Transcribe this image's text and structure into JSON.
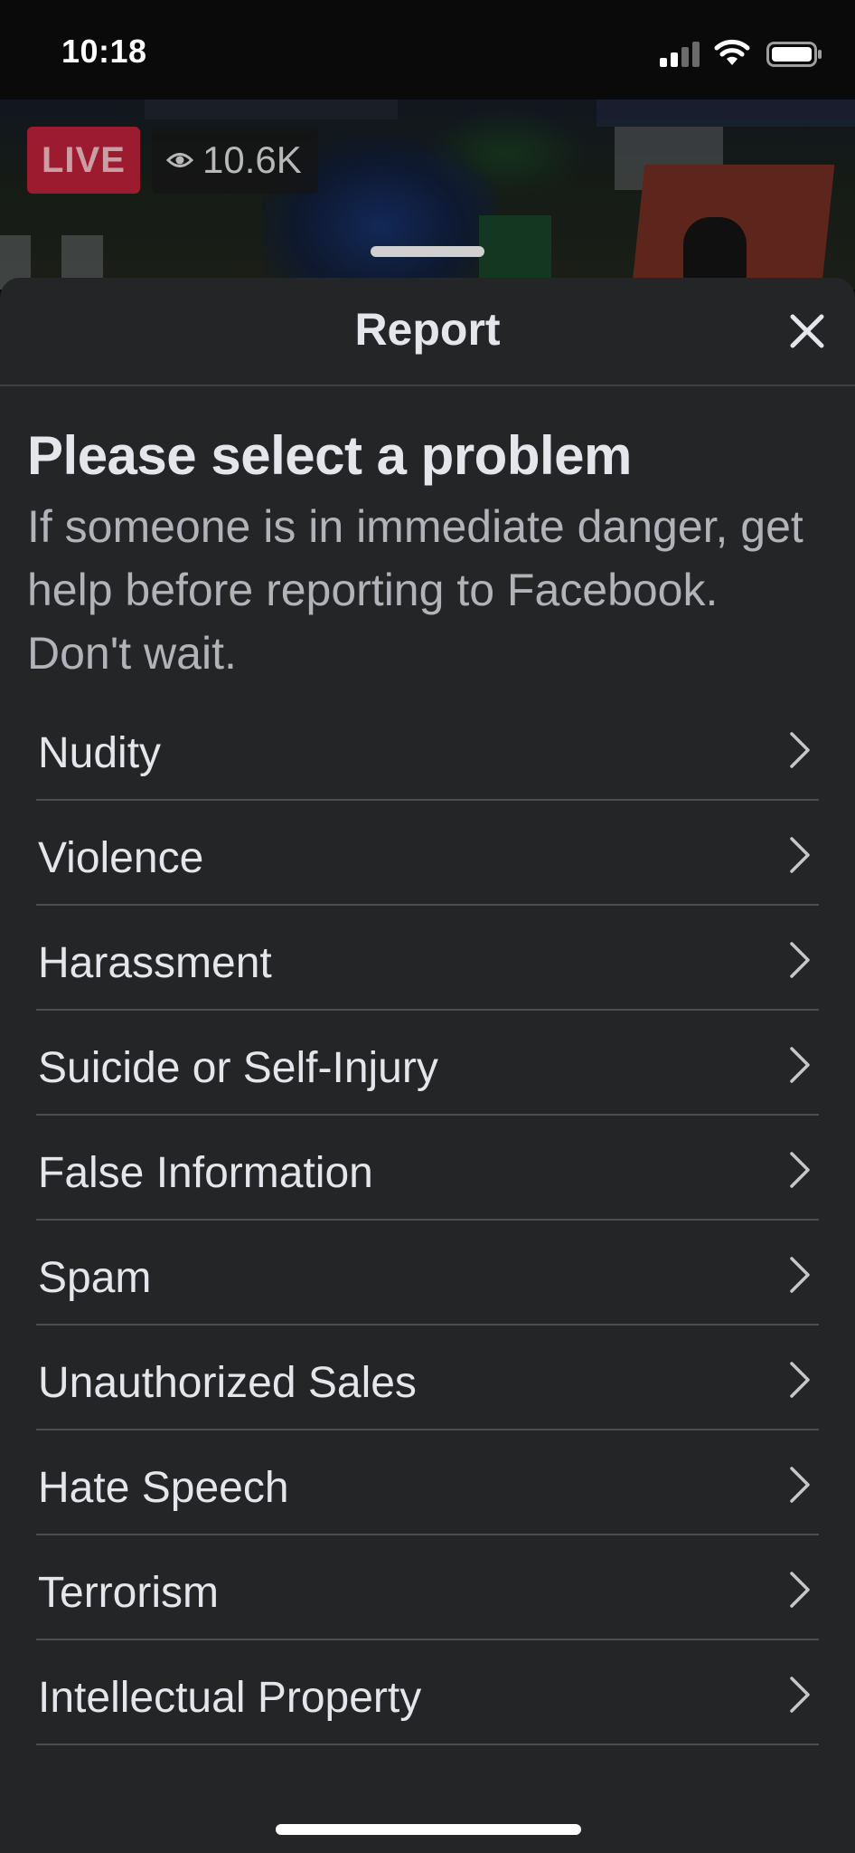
{
  "status_bar": {
    "time": "10:18"
  },
  "live_stream": {
    "live_label": "LIVE",
    "viewer_count": "10.6K"
  },
  "report_sheet": {
    "title": "Report",
    "heading": "Please select a problem",
    "subheading": "If someone is in immediate danger, get help before reporting to Facebook. Don't wait.",
    "problems": [
      "Nudity",
      "Violence",
      "Harassment",
      "Suicide or Self-Injury",
      "False Information",
      "Spam",
      "Unauthorized Sales",
      "Hate Speech",
      "Terrorism",
      "Intellectual Property"
    ]
  },
  "colors": {
    "sheet_background": "#242526",
    "primary_text": "#e4e6eb",
    "secondary_text": "#b0b3b8",
    "divider": "#4b4c4f",
    "live_red": "#b41c34"
  },
  "icons": {
    "close": "close-icon",
    "chevron": "chevron-right-icon",
    "eye": "eye-icon",
    "signal": "signal-icon",
    "wifi": "wifi-icon",
    "battery": "battery-icon"
  }
}
